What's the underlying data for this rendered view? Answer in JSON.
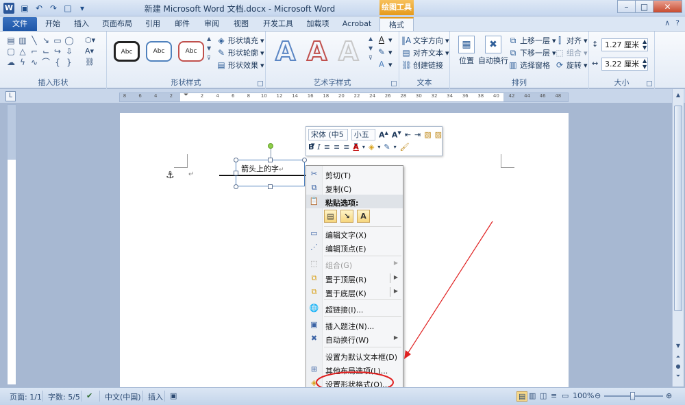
{
  "title_bar": {
    "title": "新建 Microsoft Word 文档.docx - Microsoft Word",
    "context_tab_group": "绘图工具",
    "app_letter": "W"
  },
  "tabs": [
    "文件",
    "开始",
    "插入",
    "页面布局",
    "引用",
    "邮件",
    "审阅",
    "视图",
    "开发工具",
    "加载项",
    "Acrobat",
    "格式"
  ],
  "active_tab": "格式",
  "ribbon": {
    "insert_shapes_label": "插入形状",
    "shape_styles": {
      "label": "形状样式",
      "sample": "Abc",
      "fill": "形状填充",
      "outline": "形状轮廓",
      "effects": "形状效果"
    },
    "wordart": {
      "label": "艺术字样式",
      "sample": "A"
    },
    "text": {
      "label": "文本",
      "direction": "文字方向",
      "align": "对齐文本",
      "link": "创建链接"
    },
    "arrange": {
      "label": "排列",
      "position": "位置",
      "wrap": "自动换行",
      "bring_forward": "上移一层",
      "send_backward": "下移一层",
      "selection_pane": "选择窗格",
      "align": "对齐",
      "group": "组合",
      "rotate": "旋转"
    },
    "size": {
      "label": "大小",
      "height": "1.27 厘米",
      "width": "3.22 厘米"
    }
  },
  "ruler": {
    "ticks": [
      "8",
      "6",
      "4",
      "2",
      "",
      "2",
      "4",
      "6",
      "8",
      "10",
      "12",
      "14",
      "16",
      "18",
      "20",
      "22",
      "24",
      "26",
      "28",
      "30",
      "32",
      "34",
      "36",
      "38",
      "40",
      "42",
      "44",
      "46",
      "48"
    ]
  },
  "document": {
    "textbox_text": "箭头上的字",
    "para_mark": "↵"
  },
  "mini_toolbar": {
    "font": "宋体 (中5",
    "size": "小五"
  },
  "context_menu": {
    "items": [
      {
        "label": "剪切(T)",
        "icon": "cut-icon",
        "enabled": true
      },
      {
        "label": "复制(C)",
        "icon": "copy-icon",
        "enabled": true
      },
      {
        "label": "粘贴选项:",
        "icon": "paste-icon",
        "enabled": true
      },
      {
        "label": "编辑文字(X)",
        "icon": "edit-text-icon",
        "enabled": true
      },
      {
        "label": "编辑顶点(E)",
        "icon": "edit-points-icon",
        "enabled": true
      },
      {
        "label": "组合(G)",
        "icon": "group-icon",
        "enabled": false
      },
      {
        "label": "置于顶层(R)",
        "icon": "bring-to-front-icon",
        "enabled": true
      },
      {
        "label": "置于底层(K)",
        "icon": "send-to-back-icon",
        "enabled": true
      },
      {
        "label": "超链接(I)...",
        "icon": "hyperlink-icon",
        "enabled": true
      },
      {
        "label": "插入题注(N)...",
        "icon": "caption-icon",
        "enabled": true
      },
      {
        "label": "自动换行(W)",
        "icon": "wrap-icon",
        "enabled": true
      },
      {
        "label": "设置为默认文本框(D)",
        "icon": "",
        "enabled": true
      },
      {
        "label": "其他布局选项(L)...",
        "icon": "layout-icon",
        "enabled": true
      },
      {
        "label": "设置形状格式(O)...",
        "icon": "format-shape-icon",
        "enabled": true
      }
    ]
  },
  "status_bar": {
    "page": "页面: 1/1",
    "words": "字数: 5/5",
    "language": "中文(中国)",
    "mode": "插入",
    "zoom": "100%"
  },
  "colors": {
    "annotation": "#e02020",
    "file_tab": "#1e56a8",
    "context_tab": "#e59a1c"
  }
}
